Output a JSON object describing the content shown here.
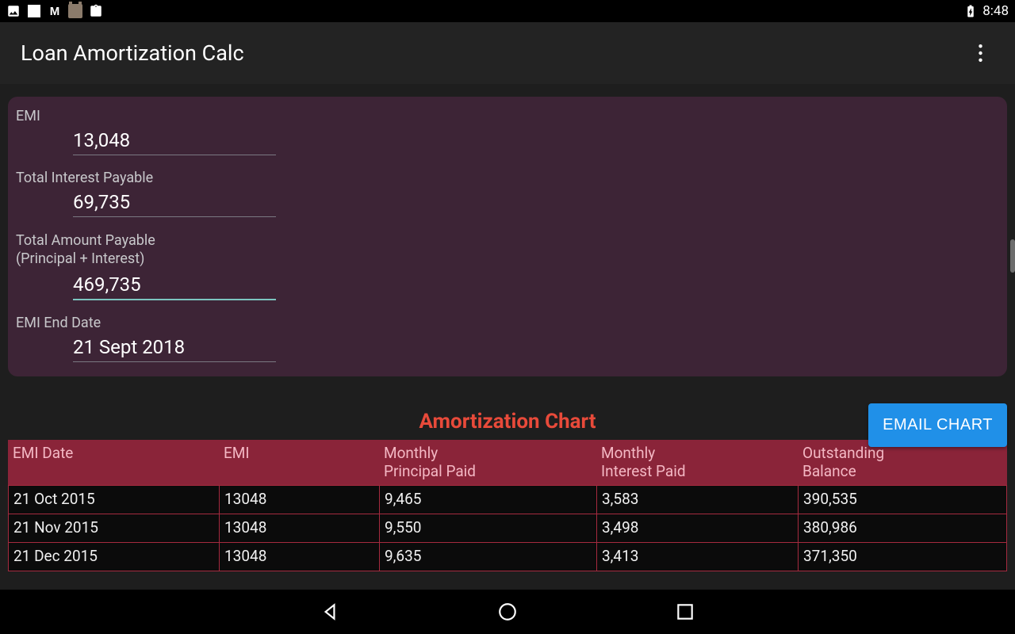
{
  "statusBar": {
    "time": "8:48"
  },
  "appBar": {
    "title": "Loan Amortization Calc"
  },
  "summary": {
    "emi": {
      "label": "EMI",
      "value": "13,048"
    },
    "interest": {
      "label": "Total Interest Payable",
      "value": "69,735"
    },
    "total": {
      "label_l1": "Total Amount Payable",
      "label_l2": "(Principal + Interest)",
      "value": "469,735"
    },
    "endDate": {
      "label": "EMI End Date",
      "value": "21 Sept 2018"
    }
  },
  "chart": {
    "title": "Amortization Chart",
    "emailButton": "EMAIL CHART",
    "headers": {
      "date": "EMI Date",
      "emi": "EMI",
      "pp_l1": "Monthly",
      "pp_l2": "Principal Paid",
      "ip_l1": "Monthly",
      "ip_l2": "Interest Paid",
      "bal_l1": "Outstanding",
      "bal_l2": "Balance"
    },
    "rows": [
      {
        "date": "21 Oct 2015",
        "emi": "13048",
        "pp": "9,465",
        "ip": "3,583",
        "bal": "390,535"
      },
      {
        "date": "21 Nov 2015",
        "emi": "13048",
        "pp": "9,550",
        "ip": "3,498",
        "bal": "380,986"
      },
      {
        "date": "21 Dec 2015",
        "emi": "13048",
        "pp": "9,635",
        "ip": "3,413",
        "bal": "371,350"
      }
    ]
  }
}
